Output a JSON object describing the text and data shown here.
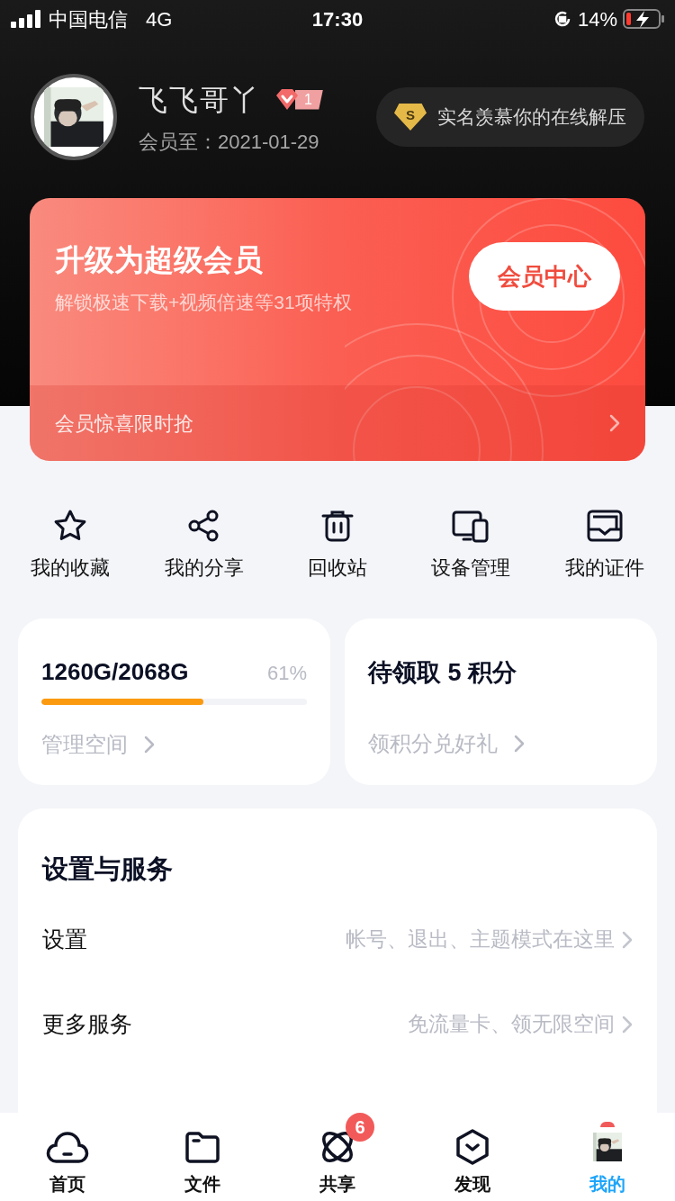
{
  "status_bar": {
    "carrier": "中国电信",
    "network": "4G",
    "time": "17:30",
    "battery": "14%"
  },
  "profile": {
    "name": "飞飞哥丫",
    "vip_level": "1",
    "expiry": "会员至：2021-01-29",
    "badge_letter": "S",
    "badge_text": "实名羡慕你的在线解压"
  },
  "vip_card": {
    "title": "升级为超级会员",
    "subtitle": "解锁极速下载+视频倍速等31项特权",
    "button": "会员中心",
    "promo": "会员惊喜限时抢"
  },
  "shortcuts": [
    {
      "kind": "star",
      "label": "我的收藏"
    },
    {
      "kind": "share",
      "label": "我的分享"
    },
    {
      "kind": "trash",
      "label": "回收站"
    },
    {
      "kind": "devices",
      "label": "设备管理"
    },
    {
      "kind": "card",
      "label": "我的证件"
    }
  ],
  "storage": {
    "usage": "1260G/2068G",
    "percent": "61%",
    "level": 0.61,
    "link": "管理空间"
  },
  "points": {
    "title": "待领取 5 积分",
    "link": "领积分兑好礼"
  },
  "settings": {
    "title": "设置与服务",
    "rows": [
      {
        "label": "设置",
        "hint": "帐号、退出、主题模式在这里"
      },
      {
        "label": "更多服务",
        "hint": "免流量卡、领无限空间"
      }
    ]
  },
  "tabs": [
    {
      "kind": "cloud",
      "label": "首页",
      "selected": false
    },
    {
      "kind": "folder",
      "label": "文件",
      "selected": false
    },
    {
      "kind": "orbit",
      "label": "共享",
      "selected": false,
      "badge": "6"
    },
    {
      "kind": "hexagon",
      "label": "发现",
      "selected": false
    },
    {
      "kind": "avatar",
      "label": "我的",
      "selected": true
    }
  ]
}
